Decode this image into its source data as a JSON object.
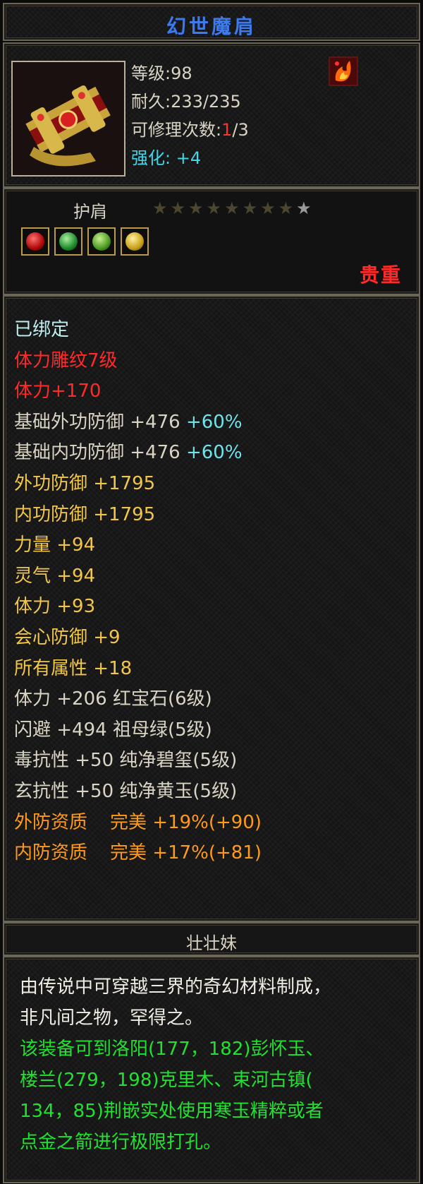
{
  "item": {
    "name": "幻世魔肩",
    "level_label": "等级:98",
    "durability_prefix": "耐久:",
    "durability_value": "233/235",
    "repair_prefix": "可修理次数:",
    "repair_used": "1",
    "repair_total": "/3",
    "enhance_label": "强化:",
    "enhance_value": "+4",
    "slot": "护肩",
    "stars_total": 9,
    "stars_lit": 1,
    "quality": "贵重",
    "gems": [
      {
        "name": "ruby",
        "color": "#d81818"
      },
      {
        "name": "emerald",
        "color": "#2aa838"
      },
      {
        "name": "jade",
        "color": "#5fb830"
      },
      {
        "name": "yellow-jade",
        "color": "#d8b020"
      }
    ]
  },
  "attributes": [
    {
      "text": "已绑定",
      "color": "white"
    },
    {
      "text": "体力雕纹7级",
      "color": "red"
    },
    {
      "text": "体力+170",
      "color": "red"
    },
    {
      "text": "基础外功防御 +476",
      "extra": "+60%",
      "color": "white"
    },
    {
      "text": "基础内功防御 +476",
      "extra": "+60%",
      "color": "white"
    },
    {
      "text": "外功防御 +1795",
      "color": "yellow"
    },
    {
      "text": "内功防御 +1795",
      "color": "yellow"
    },
    {
      "text": "力量 +94",
      "color": "yellow"
    },
    {
      "text": "灵气 +94",
      "color": "yellow"
    },
    {
      "text": "体力 +93",
      "color": "yellow"
    },
    {
      "text": "会心防御 +9",
      "color": "yellow"
    },
    {
      "text": "所有属性 +18",
      "color": "yellow"
    },
    {
      "text": "体力 +206 红宝石(6级)",
      "color": "white"
    },
    {
      "text": "闪避 +494 祖母绿(5级)",
      "color": "white"
    },
    {
      "text": "毒抗性 +50 纯净碧玺(5级)",
      "color": "white"
    },
    {
      "text": "玄抗性 +50 纯净黄玉(5级)",
      "color": "white"
    },
    {
      "text": "外防资质",
      "extra2": "完美 +19%(+90)",
      "color": "orange"
    },
    {
      "text": "内防资质",
      "extra2": "完美 +17%(+81)",
      "color": "orange"
    }
  ],
  "maker": "壮壮妹",
  "description": {
    "line1": "由传说中可穿越三界的奇幻材料制成，",
    "line2": "非凡间之物，罕得之。",
    "line3": "该装备可到洛阳(177，182)彭怀玉、",
    "line4": "楼兰(279，198)克里木、束河古镇(",
    "line5": "134，85)荆嵌实处使用寒玉精粹或者",
    "line6": "点金之箭进行极限打孔。"
  }
}
